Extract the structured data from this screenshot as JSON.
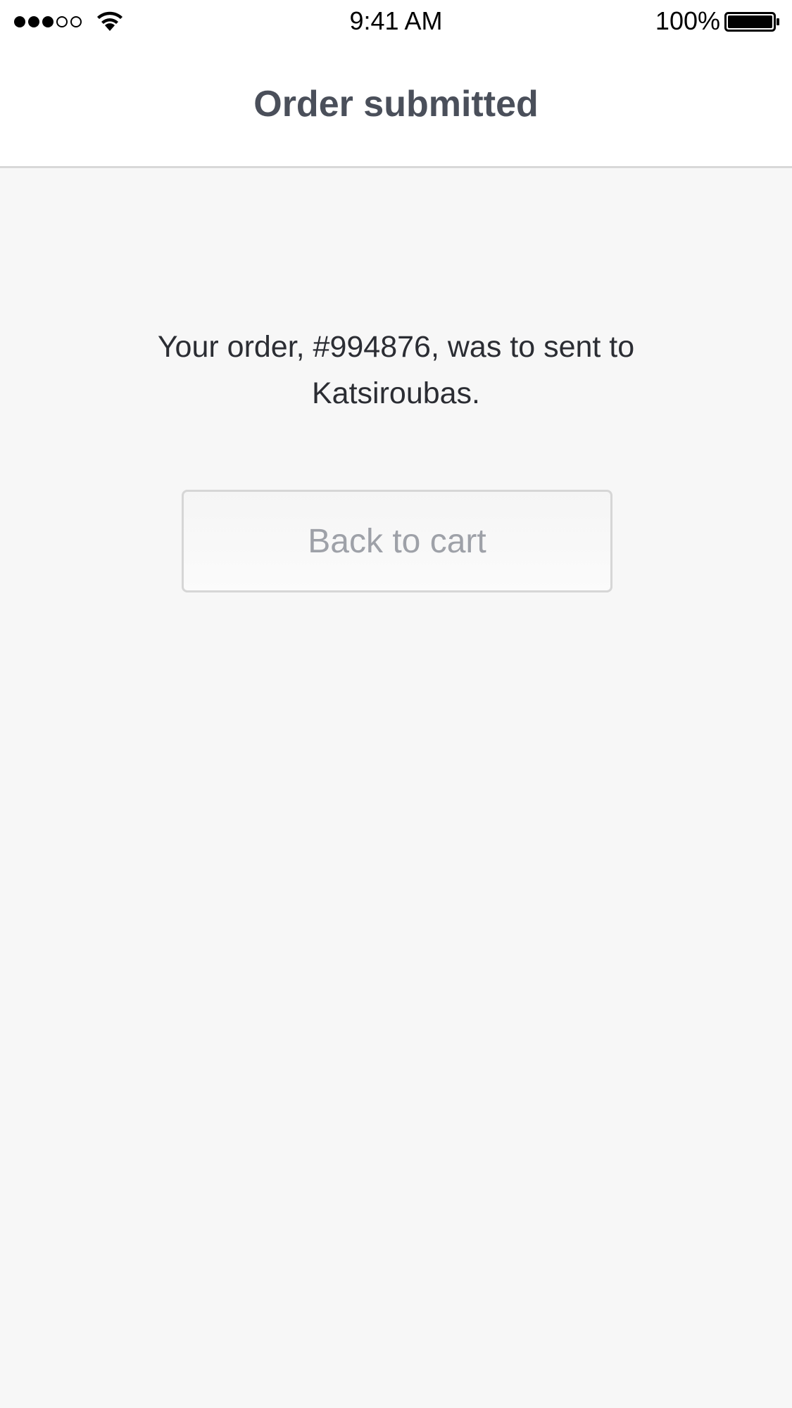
{
  "status_bar": {
    "signal_strength": "3 of 5 bars",
    "time": "9:41 AM",
    "battery_percent": "100%",
    "battery_level": 1.0
  },
  "nav": {
    "title": "Order submitted"
  },
  "main": {
    "message": "Your order, #994876, was to sent to Katsiroubas.",
    "back_button_label": "Back to cart"
  },
  "colors": {
    "background": "#f7f7f7",
    "nav_title": "#4a4f5a",
    "message_text": "#2b2d33",
    "button_text": "#9ea1a8",
    "button_border": "#d6d6d6"
  }
}
